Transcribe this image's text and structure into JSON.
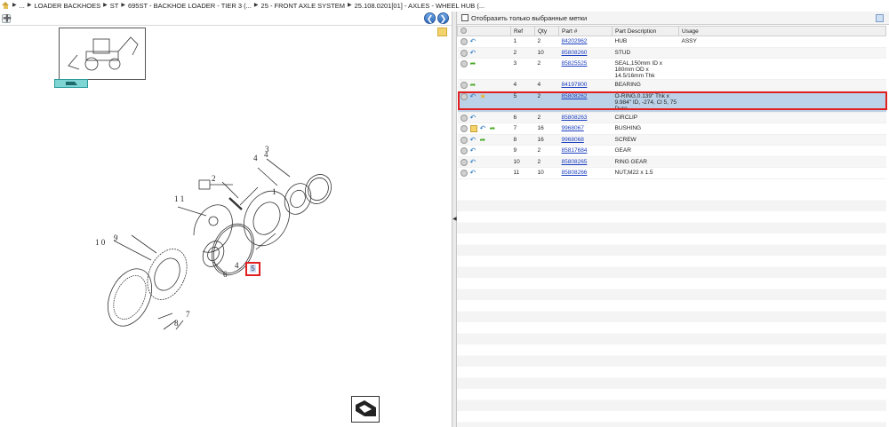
{
  "breadcrumb": {
    "items": [
      "...",
      "LOADER BACKHOES",
      "ST",
      "695ST - BACKHOE LOADER - TIER 3 (...",
      "25 - FRONT AXLE SYSTEM",
      "25.108.0201[01] - AXLES - WHEEL HUB (..."
    ],
    "separator": "▶"
  },
  "diagram": {
    "expand_glyph": "➕",
    "nav_prev": "❮",
    "nav_next": "❯",
    "hotspot_label": "5",
    "callouts": [
      "1",
      "2",
      "3",
      "4",
      "4",
      "6",
      "7",
      "8",
      "9",
      "1 0",
      "1 1"
    ]
  },
  "filter": {
    "label": "Отобразить только выбранные метки",
    "checked": false
  },
  "table": {
    "headers": [
      "",
      "Ref",
      "Qty",
      "Part #",
      "Part Description",
      "Usage"
    ],
    "rows": [
      {
        "ref": "1",
        "qty": "2",
        "part": "84202962",
        "desc": "HUB",
        "usage": "ASSY",
        "icons": [
          "info",
          "hist"
        ]
      },
      {
        "ref": "2",
        "qty": "10",
        "part": "85808260",
        "desc": "STUD",
        "usage": "",
        "icons": [
          "info",
          "hist"
        ]
      },
      {
        "ref": "3",
        "qty": "2",
        "part": "85825525",
        "desc": "SEAL,150mm ID x 180mm OD x 14.5/16mm Thk",
        "usage": "",
        "icons": [
          "info",
          "go"
        ]
      },
      {
        "ref": "4",
        "qty": "4",
        "part": "84197800",
        "desc": "BEARING",
        "usage": "",
        "icons": [
          "info",
          "go"
        ]
      },
      {
        "ref": "5",
        "qty": "2",
        "part": "85808262",
        "desc": "O-RING,0.139\" Thk x 9.984\" ID, -274, Cl 5, 75 Duro",
        "usage": "",
        "icons": [
          "info",
          "hist",
          "star"
        ],
        "selected": true
      },
      {
        "ref": "6",
        "qty": "2",
        "part": "85808263",
        "desc": "CIRCLIP",
        "usage": "",
        "icons": [
          "info",
          "hist"
        ]
      },
      {
        "ref": "7",
        "qty": "16",
        "part": "9968067",
        "desc": "BUSHING",
        "usage": "",
        "icons": [
          "info",
          "box",
          "hist",
          "go"
        ]
      },
      {
        "ref": "8",
        "qty": "16",
        "part": "9968068",
        "desc": "SCREW",
        "usage": "",
        "icons": [
          "info",
          "hist",
          "go"
        ]
      },
      {
        "ref": "9",
        "qty": "2",
        "part": "85817684",
        "desc": "GEAR",
        "usage": "",
        "icons": [
          "info",
          "hist"
        ]
      },
      {
        "ref": "10",
        "qty": "2",
        "part": "85808265",
        "desc": "RING GEAR",
        "usage": "",
        "icons": [
          "info",
          "hist"
        ]
      },
      {
        "ref": "11",
        "qty": "10",
        "part": "85808266",
        "desc": "NUT,M22 x 1.5",
        "usage": "",
        "icons": [
          "info",
          "hist"
        ]
      }
    ]
  },
  "colors": {
    "selected_row": "#bcd2e8",
    "highlight": "#e02020",
    "link": "#1b3fc0"
  }
}
